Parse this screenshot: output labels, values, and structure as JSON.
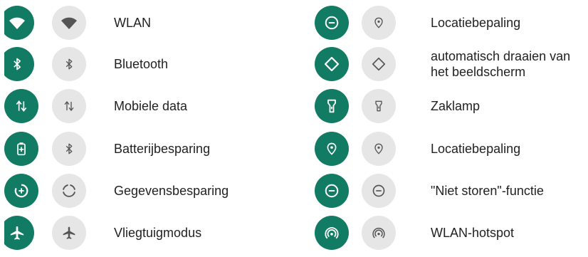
{
  "colors": {
    "active": "#127b63",
    "inactive": "#e6e6e6",
    "icon_active": "#ffffff",
    "icon_inactive": "#555555"
  },
  "left_column": [
    {
      "label": "WLAN",
      "icon": "wifi-icon"
    },
    {
      "label": "Bluetooth",
      "icon": "bluetooth-icon"
    },
    {
      "label": "Mobiele data",
      "icon": "mobile-data-icon"
    },
    {
      "label": "Batterijbesparing",
      "icon": "battery-saver-icon"
    },
    {
      "label": "Gegevensbesparing",
      "icon": "data-saver-icon"
    },
    {
      "label": "Vliegtuigmodus",
      "icon": "airplane-icon"
    }
  ],
  "right_column": [
    {
      "label": "Locatiebepaling",
      "icon": "do-not-disturb-icon"
    },
    {
      "label": "automatisch draaien van het beeldscherm",
      "icon": "auto-rotate-icon"
    },
    {
      "label": "Zaklamp",
      "icon": "flashlight-icon"
    },
    {
      "label": "Locatiebepaling",
      "icon": "location-icon"
    },
    {
      "label": "\"Niet storen\"-functie",
      "icon": "do-not-disturb-icon"
    },
    {
      "label": "WLAN-hotspot",
      "icon": "hotspot-icon"
    }
  ]
}
